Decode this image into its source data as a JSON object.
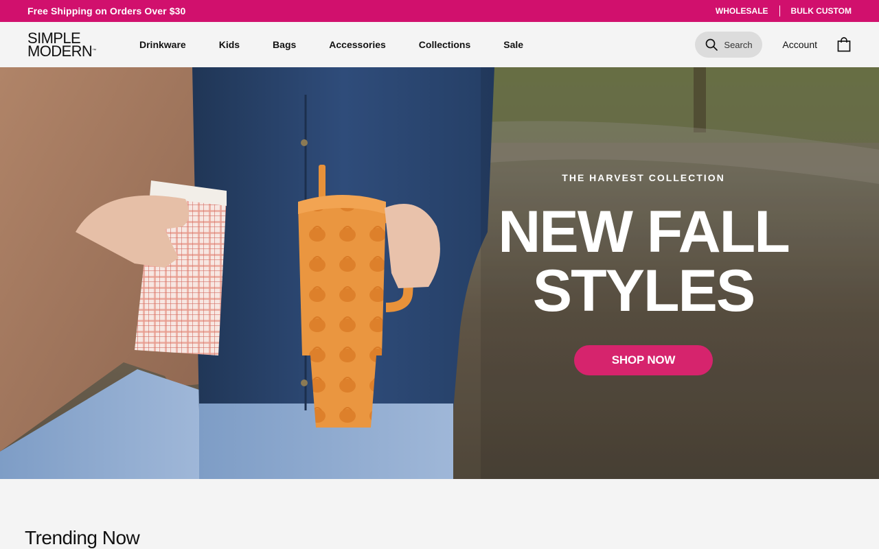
{
  "announcement": {
    "promo": "Free Shipping on Orders Over $30",
    "links": [
      "WHOLESALE",
      "BULK CUSTOM"
    ]
  },
  "header": {
    "logo": {
      "line1": "SIMPLE",
      "line2": "MODERN",
      "mark": "™"
    },
    "nav": [
      "Drinkware",
      "Kids",
      "Bags",
      "Accessories",
      "Collections",
      "Sale"
    ],
    "search_label": "Search",
    "account_label": "Account",
    "icons": {
      "search": "search-icon",
      "cart": "shopping-bag-icon"
    }
  },
  "hero": {
    "eyebrow": "THE HARVEST COLLECTION",
    "headline_line1": "NEW FALL",
    "headline_line2": "STYLES",
    "cta": "SHOP NOW"
  },
  "section": {
    "trending_title": "Trending Now"
  },
  "colors": {
    "brand_pink": "#d1106d",
    "cta_pink": "#d6246d",
    "tumbler_orange": "#e8923a",
    "denim": "#2e4a78"
  }
}
